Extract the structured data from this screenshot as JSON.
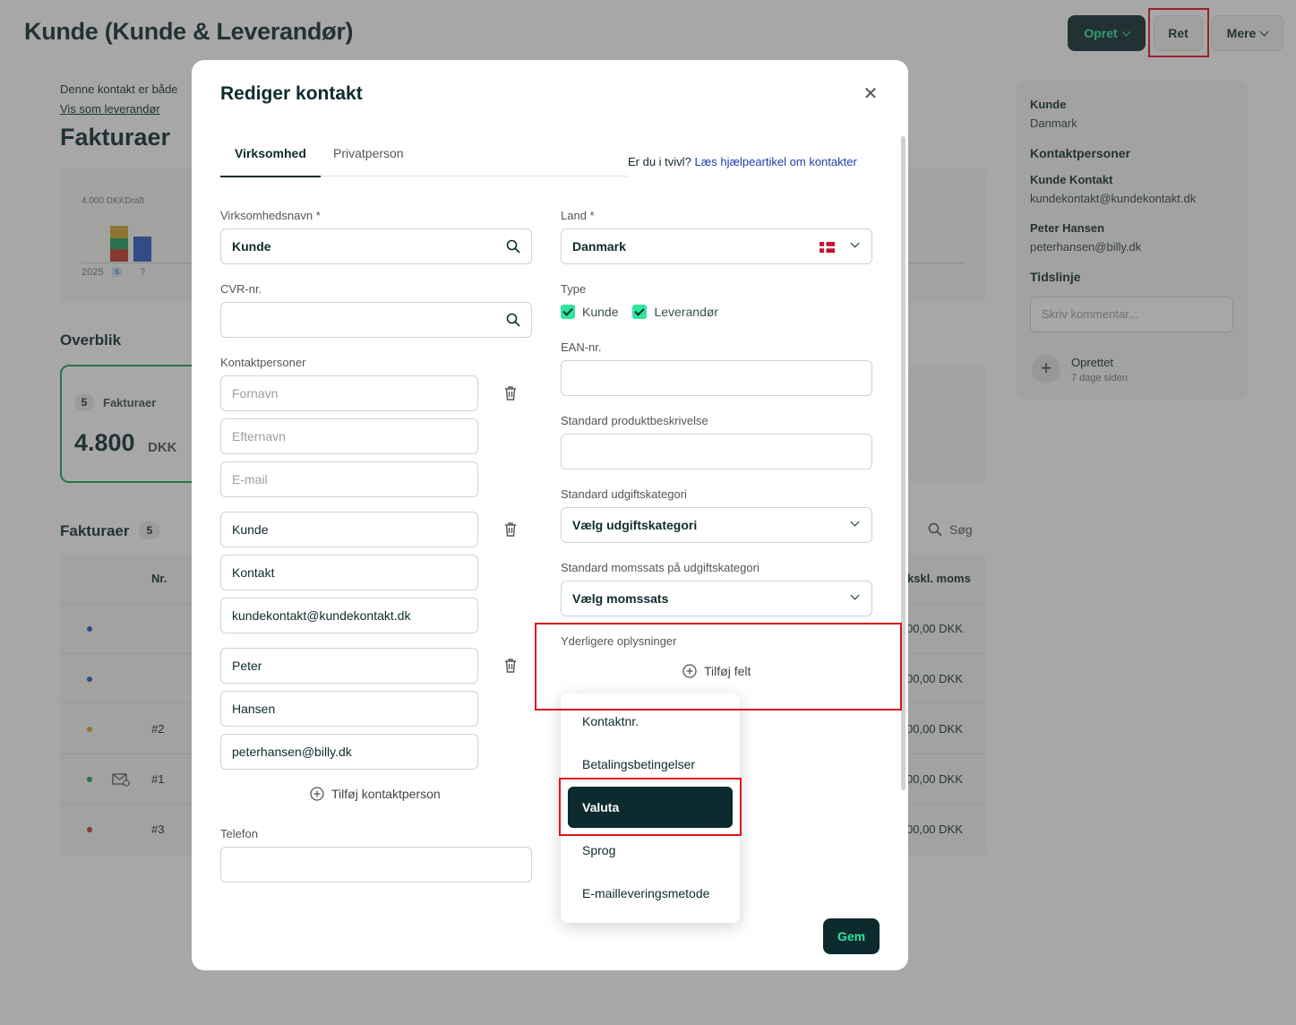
{
  "header": {
    "title": "Kunde (Kunde & Leverandør)",
    "btn_create": "Opret",
    "btn_edit": "Ret",
    "btn_more": "Mere"
  },
  "left": {
    "notice": "Denne kontakt er både",
    "view_as_supplier": "Vis som leverandør",
    "invoices_title": "Fakturaer",
    "chart_top_label": "4.000 DKK",
    "chart_draft_label": "Draft",
    "chart_year": "2025",
    "chart_s": "s",
    "chart_q": "?",
    "overview_title": "Overblik",
    "overview_count": "5",
    "overview_label": "Fakturaer",
    "overview_amount": "4.800",
    "overview_currency": "DKK",
    "list_title": "Fakturaer",
    "list_count": "5",
    "search_label": "Søg",
    "col_nr": "Nr.",
    "col_excl": "kskl. moms",
    "rows": [
      {
        "nr": "",
        "amount": "00,00 DKK",
        "color": "#2b59c3"
      },
      {
        "nr": "",
        "amount": "00,00 DKK",
        "color": "#2b59c3"
      },
      {
        "nr": "#2",
        "amount": "00,00 DKK",
        "color": "#d4a72c"
      },
      {
        "nr": "#1",
        "amount": "00,00 DKK",
        "color": "#1a9e5b"
      },
      {
        "nr": "#3",
        "amount": "00,00 DKK",
        "color": "#c0392b"
      }
    ]
  },
  "right": {
    "name": "Kunde",
    "country": "Danmark",
    "contacts_title": "Kontaktpersoner",
    "c1_name": "Kunde Kontakt",
    "c1_email": "kundekontakt@kundekontakt.dk",
    "c2_name": "Peter Hansen",
    "c2_email": "peterhansen@billy.dk",
    "timeline_title": "Tidslinje",
    "comment_placeholder": "Skriv kommentar...",
    "event_title": "Oprettet",
    "event_time": "7 dage siden"
  },
  "modal": {
    "title": "Rediger kontakt",
    "tab_company": "Virksomhed",
    "tab_private": "Privatperson",
    "help_text": "Er du i tvivl?",
    "help_link": "Læs hjælpeartikel om kontakter",
    "company_name_label": "Virksomhedsnavn *",
    "company_name_value": "Kunde",
    "cvr_label": "CVR-nr.",
    "contacts_label": "Kontaktpersoner",
    "ph_first": "Fornavn",
    "ph_last": "Efternavn",
    "ph_email": "E-mail",
    "c1_first": "Kunde",
    "c1_last": "Kontakt",
    "c1_email": "kundekontakt@kundekontakt.dk",
    "c2_first": "Peter",
    "c2_last": "Hansen",
    "c2_email": "peterhansen@billy.dk",
    "add_contact": "Tilføj kontaktperson",
    "phone_label": "Telefon",
    "country_label": "Land *",
    "country_value": "Danmark",
    "type_label": "Type",
    "type_customer": "Kunde",
    "type_supplier": "Leverandør",
    "ean_label": "EAN-nr.",
    "product_desc_label": "Standard produktbeskrivelse",
    "expense_cat_label": "Standard udgiftskategori",
    "expense_cat_value": "Vælg udgiftskategori",
    "vat_label": "Standard momssats på udgiftskategori",
    "vat_value": "Vælg momssats",
    "extra_label": "Yderligere oplysninger",
    "add_field": "Tilføj felt",
    "save": "Gem"
  },
  "dropdown": {
    "items": [
      "Kontaktnr.",
      "Betalingsbetingelser",
      "Valuta",
      "Sprog",
      "E-mailleveringsmetode"
    ],
    "selected": "Valuta"
  },
  "colors": {
    "brand_dark": "#0d2b2e",
    "brand_green": "#2ee59d",
    "highlight_red": "#e0121b"
  }
}
